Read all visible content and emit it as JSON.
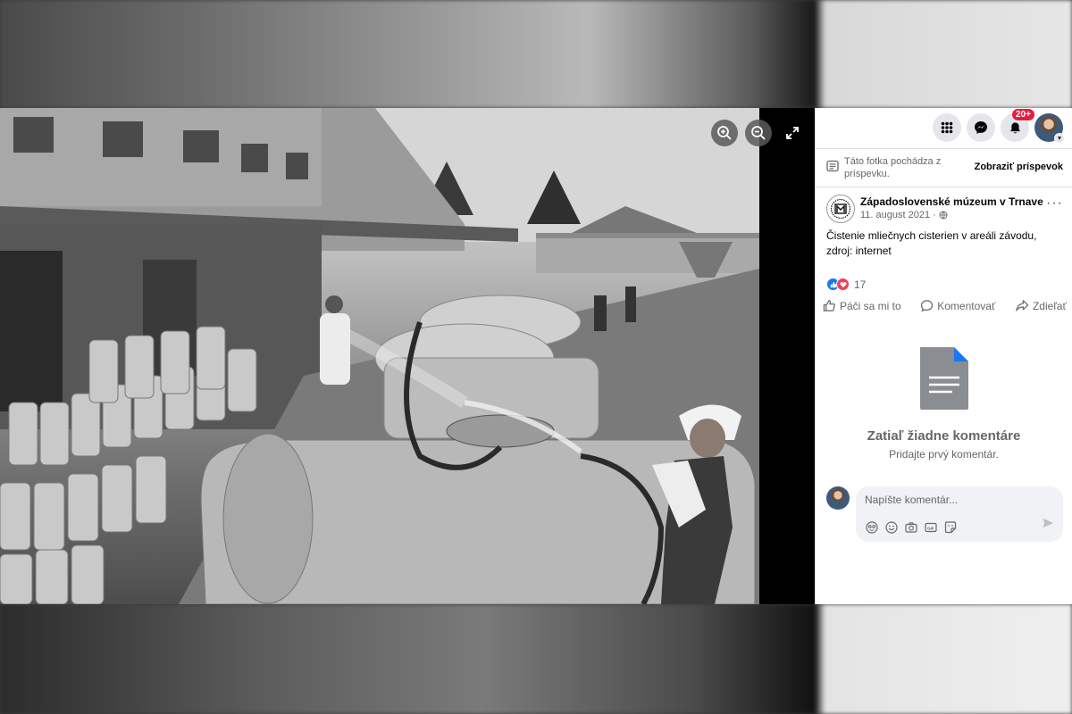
{
  "viewer": {
    "zoom_in_icon": "zoom-in-icon",
    "zoom_out_icon": "zoom-out-icon",
    "fullscreen_icon": "fullscreen-icon"
  },
  "topbar": {
    "menu_icon": "grid-menu-icon",
    "messenger_icon": "messenger-icon",
    "notifications_icon": "bell-icon",
    "notifications_badge": "20+"
  },
  "notice": {
    "text": "Táto fotka pochádza z príspevku.",
    "link": "Zobraziť príspevok"
  },
  "post": {
    "page_name": "Západoslovenské múzeum v Trnave",
    "date": "11. august 2021 ·",
    "text": "Čistenie mliečnych cisterien v areáli závodu, zdroj: internet",
    "reaction_count": "17"
  },
  "actions": {
    "like": "Páči sa mi to",
    "comment": "Komentovať",
    "share": "Zdieľať"
  },
  "comments": {
    "empty_title": "Zatiaľ žiadne komentáre",
    "empty_subtitle": "Pridajte prvý komentár.",
    "placeholder": "Napíšte komentár..."
  },
  "colors": {
    "accent": "#1877f2",
    "badge": "#e41e3f",
    "love": "#f33e58"
  }
}
